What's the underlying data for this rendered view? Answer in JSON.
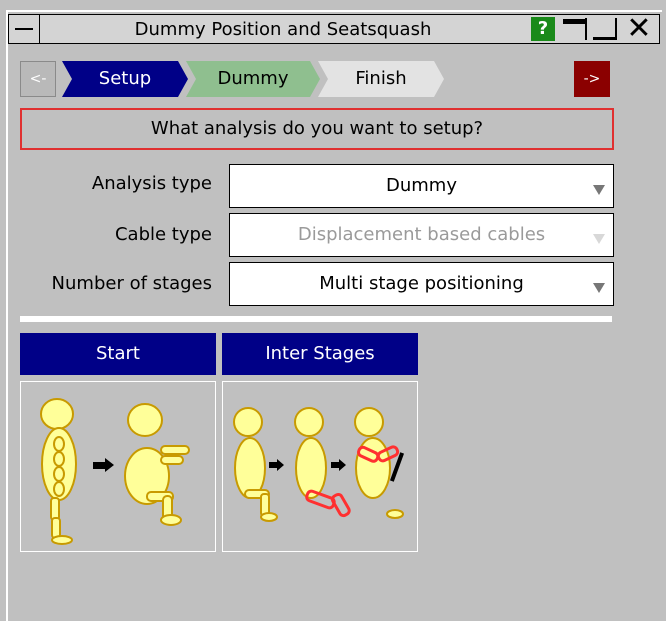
{
  "window": {
    "title": "Dummy Position and Seatsquash",
    "help_label": "?",
    "close_label": "✕"
  },
  "wizard": {
    "back_label": "<-",
    "next_label": "->",
    "steps": [
      {
        "label": "Setup"
      },
      {
        "label": "Dummy"
      },
      {
        "label": "Finish"
      }
    ]
  },
  "question": "What analysis do you want to setup?",
  "fields": {
    "analysis_type": {
      "label": "Analysis type",
      "value": "Dummy"
    },
    "cable_type": {
      "label": "Cable type",
      "value": "Displacement based cables"
    },
    "number_of_stages": {
      "label": "Number of stages",
      "value": "Multi stage positioning"
    }
  },
  "cards": [
    {
      "label": "Start",
      "icon": "dummy-start-positioning-icon"
    },
    {
      "label": "Inter Stages",
      "icon": "dummy-inter-stages-icon"
    }
  ],
  "colors": {
    "step_active": "#000087",
    "step_next": "#8fbf8f",
    "step_inactive": "#e3e3e3",
    "next_button": "#8b0000",
    "question_border": "#e03030",
    "dummy_body": "#ffff99",
    "dummy_highlight": "#ff3030"
  }
}
